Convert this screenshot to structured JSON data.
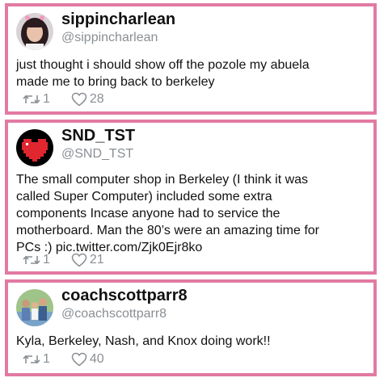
{
  "tweets": [
    {
      "display_name": "sippincharlean",
      "handle": "@sippincharlean",
      "text": "just thought i should show off the pozole my abuela\nmade me to bring back to berkeley",
      "retweets": "1",
      "likes": "28",
      "avatar_icon": "user-photo-avatar"
    },
    {
      "display_name": "SND_TST",
      "handle": "@SND_TST",
      "text": "The small computer shop in Berkeley (I think it was\ncalled Super Computer) included some extra\ncomponents Incase anyone had to service the\nmotherboard. Man the 80’s were an amazing time for\nPCs :) pic.twitter.com/Zjk0Ejr8ko",
      "retweets": "1",
      "likes": "21",
      "avatar_icon": "pixel-heart-avatar"
    },
    {
      "display_name": "coachscottparr8",
      "handle": "@coachscottparr8",
      "text": "Kyla, Berkeley, Nash, and Knox doing work!!",
      "retweets": "1",
      "likes": "40",
      "avatar_icon": "group-photo-avatar"
    }
  ],
  "colors": {
    "card_border": "#e27aa3",
    "secondary_text": "#8a8f94",
    "heart_red": "#e0262f"
  }
}
